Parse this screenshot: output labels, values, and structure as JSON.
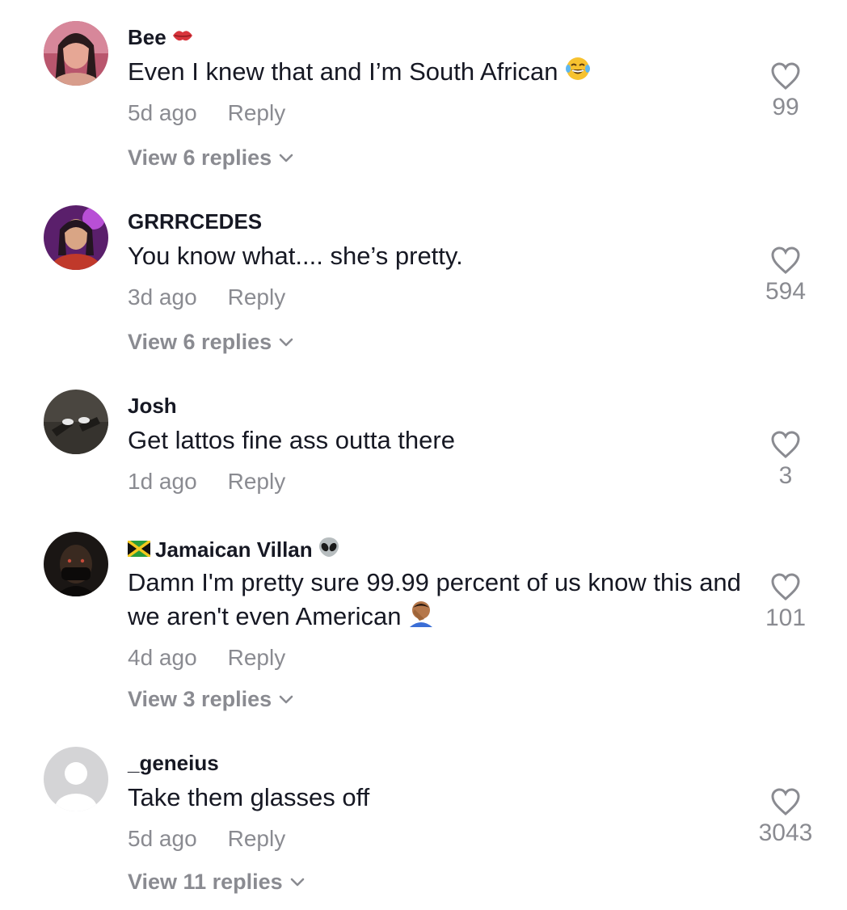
{
  "comments": [
    {
      "username": "Bee",
      "username_emoji": "kiss-mark-icon",
      "text": "Even I knew that and I’m South African",
      "text_emoji": "face-with-tears-of-joy-icon",
      "age": "5d ago",
      "reply_label": "Reply",
      "likes": "99",
      "view_replies": "View 6 replies"
    },
    {
      "username": "GRRRCEDES",
      "text": "You know what.... she’s pretty.",
      "age": "3d ago",
      "reply_label": "Reply",
      "likes": "594",
      "view_replies": "View 6 replies"
    },
    {
      "username": "Josh",
      "text": "Get lattos fine ass outta there",
      "age": "1d ago",
      "reply_label": "Reply",
      "likes": "3"
    },
    {
      "username": "Jamaican Villan",
      "username_prefix_emoji": "jamaica-flag-icon",
      "username_emoji": "alien-icon",
      "text": "Damn I'm pretty sure 99.99 percent of us know this and we aren't even American",
      "text_emoji": "man-facepalming-icon",
      "age": "4d ago",
      "reply_label": "Reply",
      "likes": "101",
      "view_replies": "View 3 replies"
    },
    {
      "username": "_geneius",
      "text": "Take them glasses off",
      "age": "5d ago",
      "reply_label": "Reply",
      "likes": "3043",
      "view_replies": "View 11 replies"
    }
  ]
}
